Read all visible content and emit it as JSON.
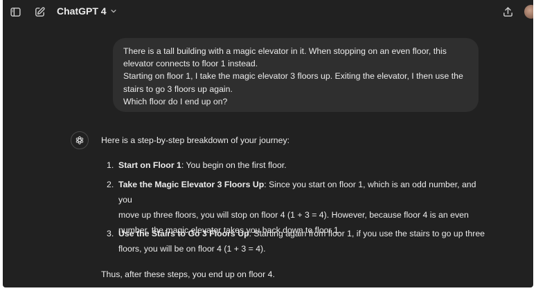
{
  "header": {
    "sidebar_icon": "sidebar-toggle-icon",
    "new_chat_icon": "new-chat-icon",
    "model_name": "ChatGPT 4",
    "model_chevron_icon": "chevron-down-icon",
    "share_icon": "share-icon"
  },
  "user_message": {
    "lines": [
      "There is a tall building with a magic elevator in it. When stopping on an even floor, this",
      "elevator connects to floor 1 instead.",
      "Starting on floor 1, I take the magic elevator 3 floors up. Exiting the elevator, I then use the",
      "stairs to go 3 floors up again.",
      "Which floor do I end up on?"
    ]
  },
  "assistant_message": {
    "avatar_icon": "openai-logo-icon",
    "intro": "Here is a step-by-step breakdown of your journey:",
    "steps": [
      {
        "number": "1.",
        "title": "Start on Floor 1",
        "lines": [
          ": You begin on the first floor."
        ]
      },
      {
        "number": "2.",
        "title": "Take the Magic Elevator 3 Floors Up",
        "lines": [
          ": Since you start on floor 1, which is an odd number, and you",
          "move up three floors, you will stop on floor 4 (1 + 3 = 4). However, because floor 4 is an even",
          "number, the magic elevator takes you back down to floor 1."
        ]
      },
      {
        "number": "3.",
        "title": "Use the Stairs to Go 3 Floors Up",
        "lines": [
          ": Starting again from floor 1, if you use the stairs to go up three",
          "floors, you will be on floor 4 (1 + 3 = 4)."
        ]
      }
    ],
    "conclusion": "Thus, after these steps, you end up on floor 4."
  }
}
